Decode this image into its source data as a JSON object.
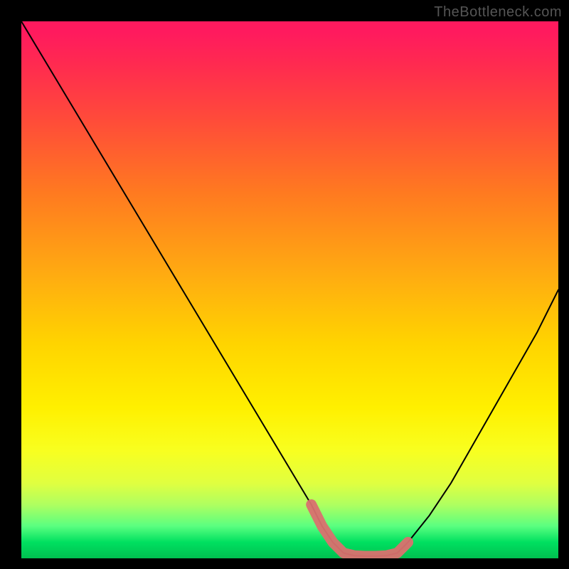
{
  "attribution": "TheBottleneck.com",
  "chart_data": {
    "type": "line",
    "title": "",
    "xlabel": "",
    "ylabel": "",
    "xlim": [
      0,
      100
    ],
    "ylim": [
      0,
      100
    ],
    "series": [
      {
        "name": "curve",
        "x": [
          0,
          6,
          12,
          18,
          24,
          30,
          36,
          42,
          48,
          54,
          56,
          58,
          60,
          62,
          64,
          66,
          68,
          70,
          72,
          76,
          80,
          84,
          88,
          92,
          96,
          100
        ],
        "values": [
          100,
          90,
          80,
          70,
          60,
          50,
          40,
          30,
          20,
          10,
          6,
          3,
          1,
          0.5,
          0.4,
          0.4,
          0.5,
          1,
          3,
          8,
          14,
          21,
          28,
          35,
          42,
          50
        ]
      },
      {
        "name": "highlight-band",
        "x": [
          54,
          56,
          58,
          60,
          62,
          64,
          66,
          68,
          70,
          72
        ],
        "values": [
          10,
          6,
          3,
          1,
          0.5,
          0.4,
          0.4,
          0.5,
          1,
          3
        ]
      }
    ],
    "colors": {
      "curve": "#000000",
      "highlight": "#d9716f"
    }
  }
}
